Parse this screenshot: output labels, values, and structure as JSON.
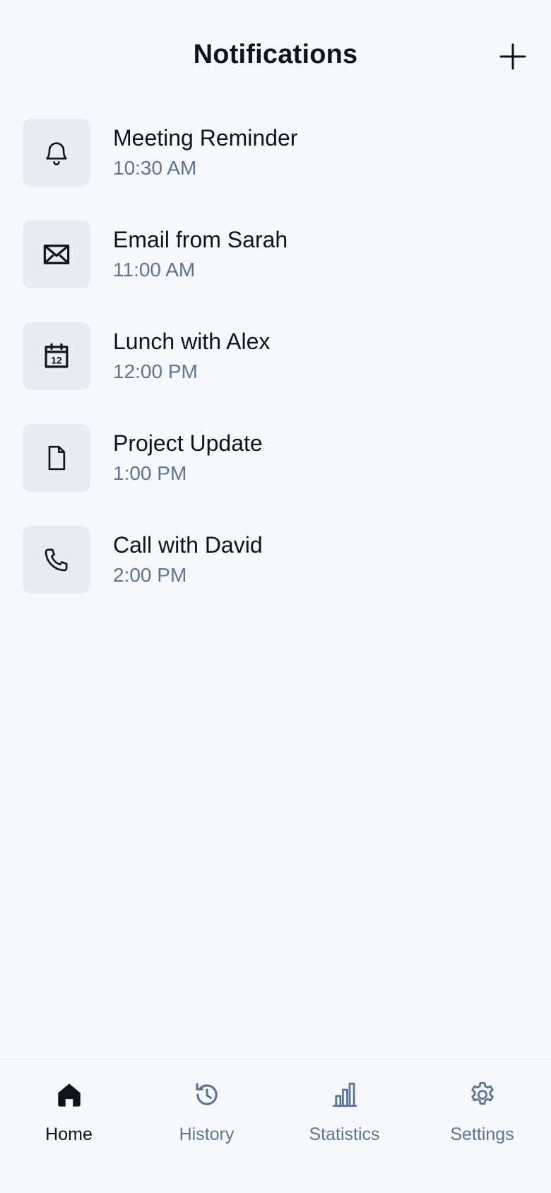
{
  "header": {
    "title": "Notifications",
    "add_icon": "plus-icon"
  },
  "notifications": [
    {
      "title": "Meeting Reminder",
      "time": "10:30 AM",
      "icon": "bell-icon"
    },
    {
      "title": "Email from Sarah",
      "time": "11:00 AM",
      "icon": "envelope-icon"
    },
    {
      "title": "Lunch with Alex",
      "time": "12:00 PM",
      "icon": "calendar-icon",
      "icon_text": "12"
    },
    {
      "title": "Project Update",
      "time": "1:00 PM",
      "icon": "file-icon"
    },
    {
      "title": "Call with David",
      "time": "2:00 PM",
      "icon": "phone-icon"
    }
  ],
  "nav": {
    "items": [
      {
        "label": "Home",
        "icon": "home-icon",
        "active": true
      },
      {
        "label": "History",
        "icon": "history-icon",
        "active": false
      },
      {
        "label": "Statistics",
        "icon": "chart-icon",
        "active": false
      },
      {
        "label": "Settings",
        "icon": "gear-icon",
        "active": false
      }
    ]
  },
  "colors": {
    "background": "#f7f9fc",
    "text_primary": "#0f141a",
    "text_secondary": "#57769a",
    "icon_tile": "#e9edf1"
  }
}
